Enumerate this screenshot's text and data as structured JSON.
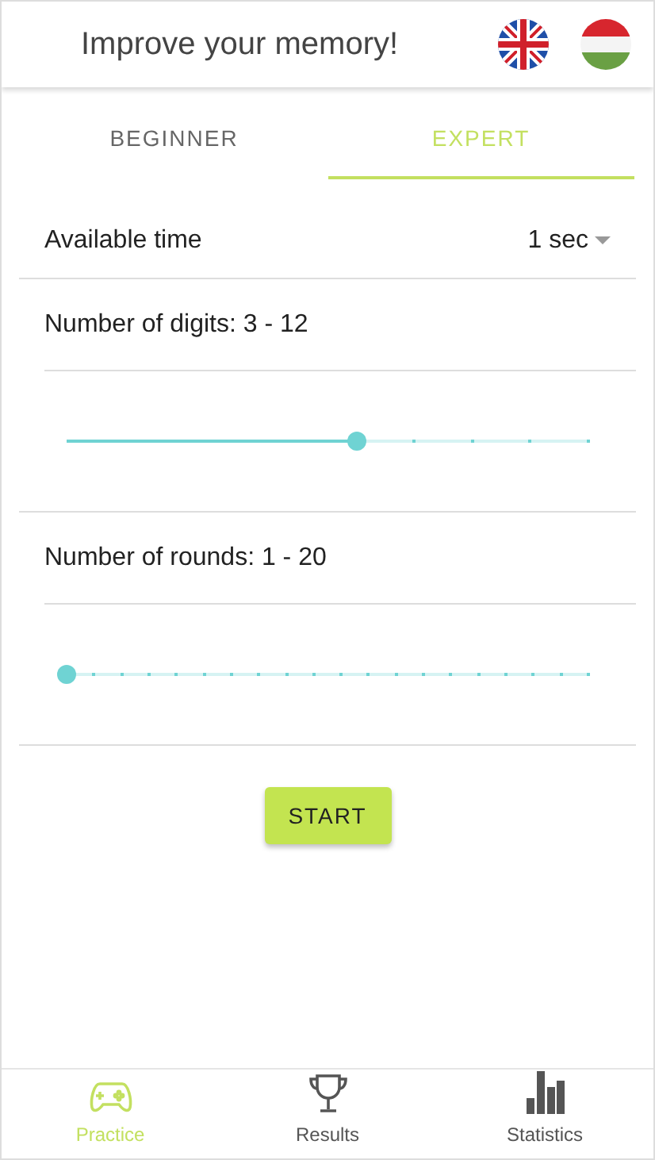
{
  "header": {
    "title": "Improve your memory!"
  },
  "tabs": [
    {
      "label": "BEGINNER",
      "selected": false
    },
    {
      "label": "EXPERT",
      "selected": true
    }
  ],
  "available_time": {
    "label": "Available time",
    "value": "1 sec"
  },
  "sliders": [
    {
      "label": "Number of digits: 3 - 12",
      "level": 0.556
    },
    {
      "label": "Number of rounds: 1 - 20",
      "level": 0
    }
  ],
  "start_button": {
    "label": "START"
  },
  "bottom_nav": [
    {
      "kind": "practice",
      "label": "Practice",
      "selected": true
    },
    {
      "kind": "results",
      "label": "Results",
      "selected": false
    },
    {
      "kind": "statistics",
      "label": "Statistics",
      "selected": false
    }
  ]
}
